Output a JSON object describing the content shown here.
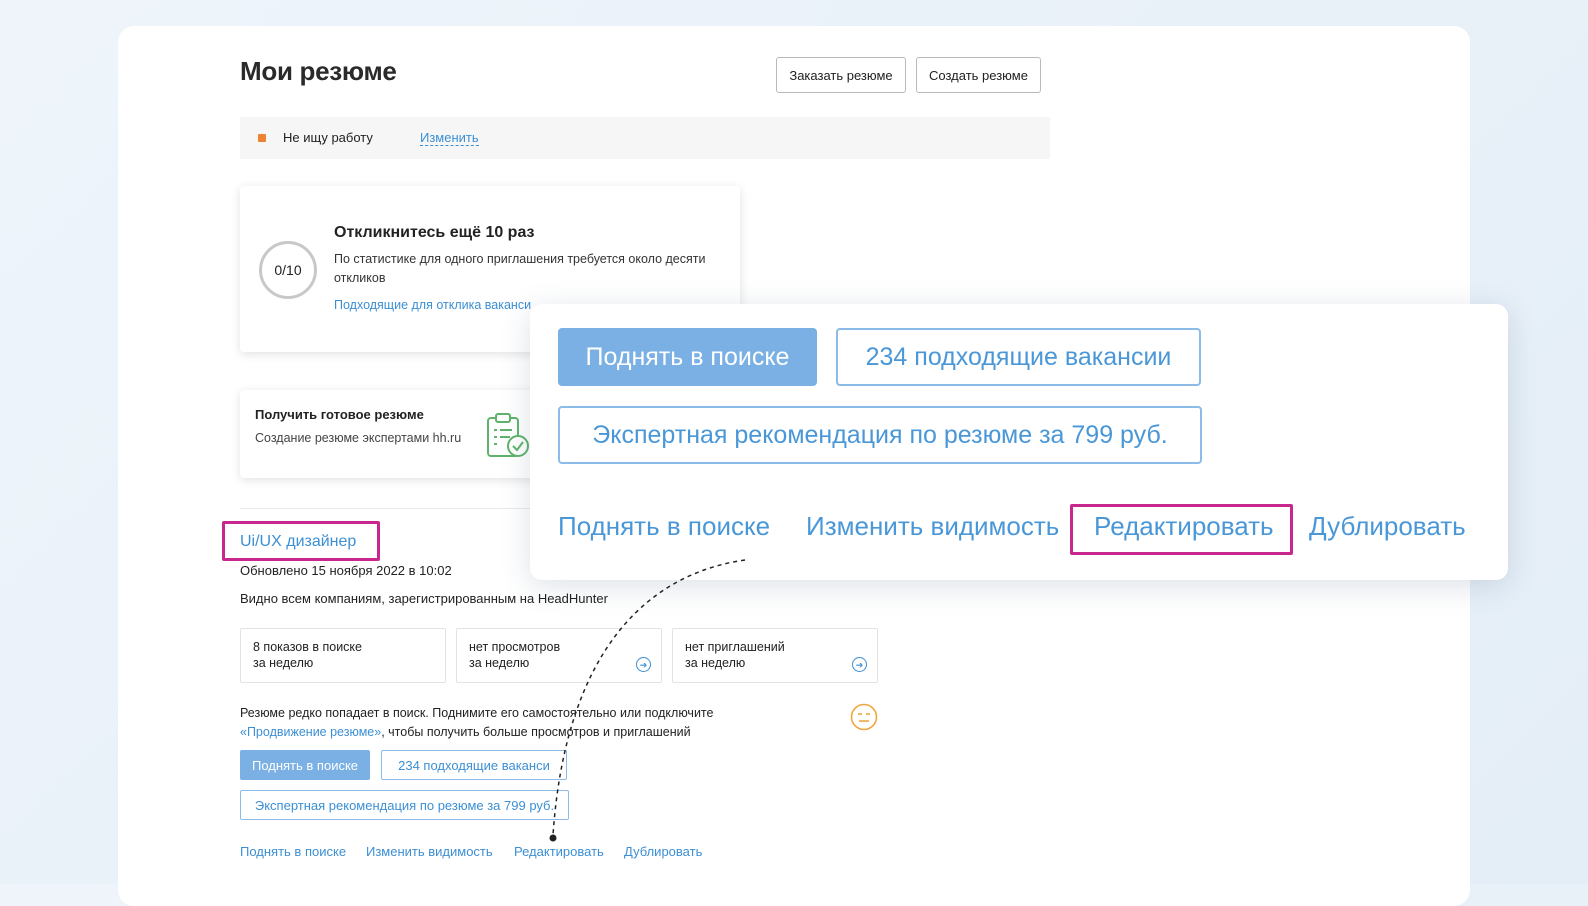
{
  "header": {
    "title": "Мои резюме",
    "order_button": "Заказать резюме",
    "create_button": "Создать резюме"
  },
  "status": {
    "text": "Не ищу работу",
    "change_link": "Изменить",
    "dot_color": "#ee8233"
  },
  "responses_card": {
    "progress": "0/10",
    "title": "Откликнитесь ещё 10 раз",
    "text": "По статистике для одного приглашения требуется около десяти откликов",
    "link": "Подходящие для отклика ваканси"
  },
  "ready_resume_card": {
    "title": "Получить готовое резюме",
    "text": "Создание резюме экспертами hh.ru",
    "icon": "clipboard-check-icon"
  },
  "resume": {
    "title": "Ui/UX дизайнер",
    "updated": "Обновлено 15 ноября 2022 в 10:02",
    "visibility": "Видно всем компаниям, зарегистрированным на HeadHunter",
    "stats": [
      {
        "line1": "8 показов в поиске",
        "line2": "за неделю",
        "has_arrow": false
      },
      {
        "line1": "нет просмотров",
        "line2": "за неделю",
        "has_arrow": true
      },
      {
        "line1": "нет приглашений",
        "line2": "за неделю",
        "has_arrow": true
      }
    ],
    "advice_part1": "Резюме редко попадает в поиск. Поднимите его самостоятельно или подключите ",
    "advice_link": "«Продвижение резюме»",
    "advice_part2": ", чтобы получить больше просмотров и приглашений",
    "raise_button": "Поднять в поиске",
    "vacancies_button": "234 подходящие ваканси",
    "expert_button": "Экспертная рекомендация по резюме за 799 руб.",
    "links": {
      "raise": "Поднять в поиске",
      "visibility": "Изменить видимость",
      "edit": "Редактировать",
      "duplicate": "Дублировать"
    }
  },
  "zoom_panel": {
    "raise_button": "Поднять в поиске",
    "vacancies_button": "234 подходящие вакансии",
    "expert_button": "Экспертная рекомендация по резюме за 799 руб.",
    "links": {
      "raise": "Поднять в поиске",
      "visibility": "Изменить видимость",
      "edit": "Редактировать",
      "duplicate": "Дублировать"
    }
  },
  "colors": {
    "accent_blue": "#3c8fd4",
    "button_blue": "#7ab0e4",
    "highlight": "#c8288e"
  }
}
